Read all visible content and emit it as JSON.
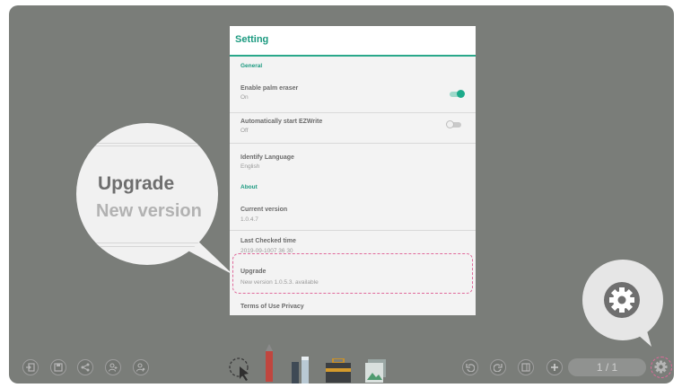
{
  "settings": {
    "title": "Setting",
    "general_section": "General",
    "palm_eraser": {
      "label": "Enable palm eraser",
      "value": "On"
    },
    "auto_start": {
      "label": "Automatically start EZWrite",
      "value": "Off"
    },
    "language": {
      "label": "Identify Language",
      "value": "English"
    },
    "about_section": "About",
    "current_version": {
      "label": "Current version",
      "value": "1.0.4.7"
    },
    "last_checked": {
      "label": "Last Checked time",
      "value": "2019-09-1007 36 30"
    },
    "upgrade": {
      "label": "Upgrade",
      "value": "New version 1.0.5.3. available"
    },
    "terms": "Terms of Use Privacy"
  },
  "magnifier": {
    "label": "Upgrade",
    "value": "New version"
  },
  "toolbar": {
    "page_indicator": "1 / 1"
  },
  "colors": {
    "accent": "#1c9a80",
    "highlight": "#e06a9b",
    "backdrop": "#7a7d79"
  }
}
